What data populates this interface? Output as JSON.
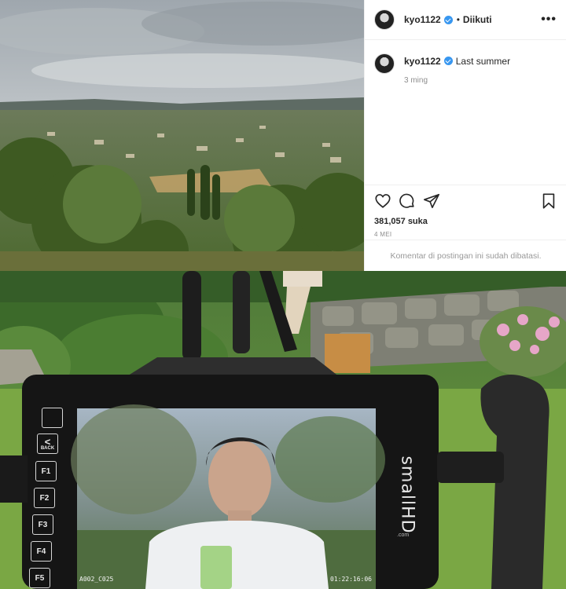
{
  "header": {
    "username": "kyo1122",
    "follow_state": "Diikuti",
    "separator": "•",
    "more_label": "•••"
  },
  "caption": {
    "username": "kyo1122",
    "text": "Last summer",
    "time_ago": "3 ming"
  },
  "stats": {
    "likes": "381,057 suka",
    "date": "4 MEI"
  },
  "comments_notice": "Komentar di postingan ini sudah dibatasi.",
  "monitor": {
    "brand": "smallHD",
    "brand_sub": ".com",
    "buttons": [
      "F1",
      "F2",
      "F3",
      "F4",
      "F5"
    ],
    "back_label": "BACK",
    "back_arrow": "<",
    "clip_name": "A002_C025",
    "timecode": "01:22:16:06"
  },
  "colors": {
    "verified": "#3897f0",
    "text": "#262626",
    "muted": "#8e8e8e"
  },
  "icons": [
    "heart-icon",
    "comment-icon",
    "share-icon",
    "bookmark-icon",
    "verified-badge-icon",
    "more-icon"
  ]
}
